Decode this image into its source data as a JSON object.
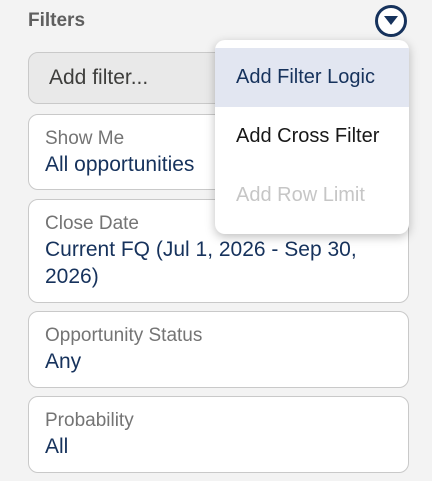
{
  "header": {
    "title": "Filters",
    "menu_icon": "circle-chevron-down-icon"
  },
  "add_filter": {
    "placeholder": "Add filter..."
  },
  "filters": [
    {
      "label": "Show Me",
      "value": "All opportunities"
    },
    {
      "label": "Close Date",
      "value": "Current FQ (Jul 1, 2026 - Sep 30, 2026)"
    },
    {
      "label": "Opportunity Status",
      "value": "Any"
    },
    {
      "label": "Probability",
      "value": "All"
    }
  ],
  "menu": {
    "items": [
      {
        "label": "Add Filter Logic",
        "state": "highlighted"
      },
      {
        "label": "Add Cross Filter",
        "state": "enabled"
      },
      {
        "label": "Add Row Limit",
        "state": "disabled"
      }
    ]
  },
  "colors": {
    "accent": "#16325c",
    "highlight": "#e2e6f1",
    "disabled": "#c6c6c6"
  }
}
